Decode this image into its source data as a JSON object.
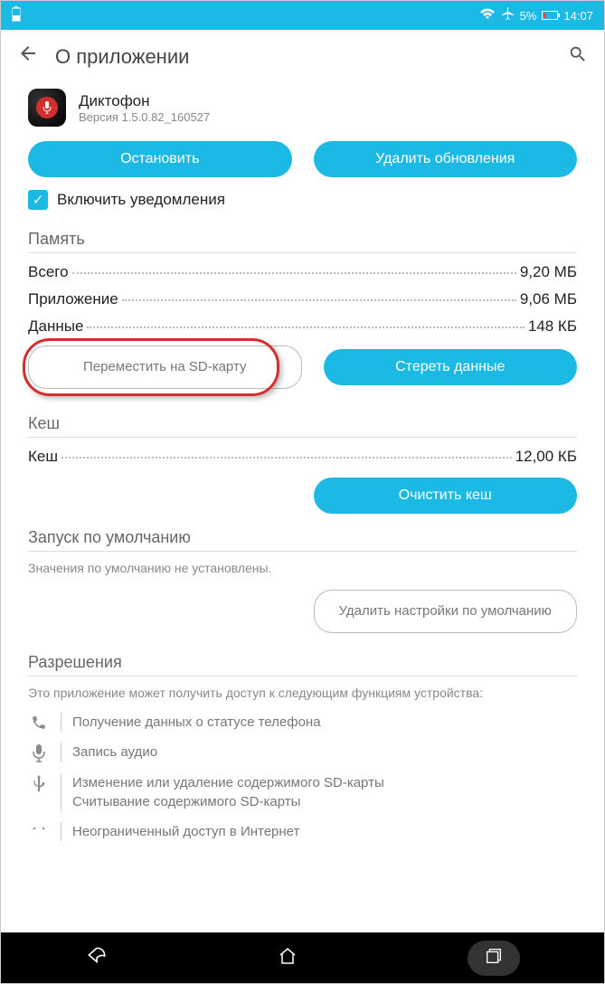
{
  "status": {
    "battery_pct": "5%",
    "time": "14:07"
  },
  "header": {
    "title": "О приложении"
  },
  "app": {
    "name": "Диктофон",
    "version": "Версия 1.5.0.82_160527"
  },
  "buttons": {
    "stop": "Остановить",
    "uninstall_updates": "Удалить обновления",
    "move_sd": "Переместить на SD-карту",
    "clear_data": "Стереть данные",
    "clear_cache": "Очистить кеш",
    "clear_defaults": "Удалить настройки по умолчанию"
  },
  "checkbox": {
    "notifications": "Включить уведомления"
  },
  "memory": {
    "title": "Память",
    "total_label": "Всего",
    "total_value": "9,20 МБ",
    "app_label": "Приложение",
    "app_value": "9,06 МБ",
    "data_label": "Данные",
    "data_value": "148 КБ"
  },
  "cache": {
    "title": "Кеш",
    "label": "Кеш",
    "value": "12,00 КБ"
  },
  "defaults": {
    "title": "Запуск по умолчанию",
    "desc": "Значения по умолчанию не установлены."
  },
  "permissions": {
    "title": "Разрешения",
    "desc": "Это приложение может получить доступ к следующим функциям устройства:",
    "phone": "Получение данных о статусе телефона",
    "audio": "Запись аудио",
    "sd1": "Изменение или удаление содержимого SD-карты",
    "sd2": "Считывание содержимого SD-карты",
    "internet": "Неограниченный доступ в Интернет"
  }
}
